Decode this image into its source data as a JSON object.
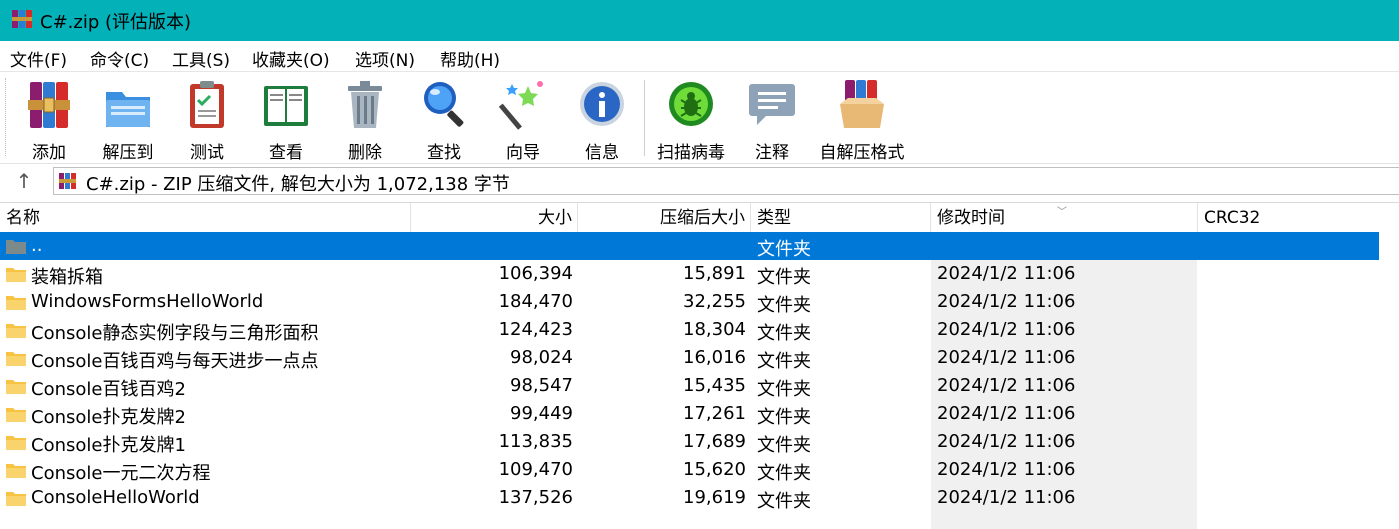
{
  "window": {
    "title": "C#.zip (评估版本)"
  },
  "menu": [
    "文件(F)",
    "命令(C)",
    "工具(S)",
    "收藏夹(O)",
    "选项(N)",
    "帮助(H)"
  ],
  "toolbar": [
    {
      "label": "添加",
      "icon": "add-archive-icon"
    },
    {
      "label": "解压到",
      "icon": "extract-folder-icon"
    },
    {
      "label": "测试",
      "icon": "test-clipboard-icon"
    },
    {
      "label": "查看",
      "icon": "view-book-icon"
    },
    {
      "label": "删除",
      "icon": "trash-icon"
    },
    {
      "label": "查找",
      "icon": "magnifier-icon"
    },
    {
      "label": "向导",
      "icon": "wizard-wand-icon"
    },
    {
      "label": "信息",
      "icon": "info-icon"
    },
    {
      "label": "扫描病毒",
      "icon": "virus-scan-icon"
    },
    {
      "label": "注释",
      "icon": "comment-icon"
    },
    {
      "label": "自解压格式",
      "icon": "sfx-archive-icon"
    }
  ],
  "address": {
    "text": "C#.zip - ZIP 压缩文件, 解包大小为 1,072,138 字节"
  },
  "columns": {
    "name": "名称",
    "size": "大小",
    "packed": "压缩后大小",
    "type": "类型",
    "modified": "修改时间",
    "crc": "CRC32"
  },
  "files": [
    {
      "name": "..",
      "size": "",
      "packed": "",
      "type": "文件夹",
      "modified": ""
    },
    {
      "name": "装箱拆箱",
      "size": "106,394",
      "packed": "15,891",
      "type": "文件夹",
      "modified": "2024/1/2 11:06"
    },
    {
      "name": "WindowsFormsHelloWorld",
      "size": "184,470",
      "packed": "32,255",
      "type": "文件夹",
      "modified": "2024/1/2 11:06"
    },
    {
      "name": "Console静态实例字段与三角形面积",
      "size": "124,423",
      "packed": "18,304",
      "type": "文件夹",
      "modified": "2024/1/2 11:06"
    },
    {
      "name": "Console百钱百鸡与每天进步一点点",
      "size": "98,024",
      "packed": "16,016",
      "type": "文件夹",
      "modified": "2024/1/2 11:06"
    },
    {
      "name": "Console百钱百鸡2",
      "size": "98,547",
      "packed": "15,435",
      "type": "文件夹",
      "modified": "2024/1/2 11:06"
    },
    {
      "name": "Console扑克发牌2",
      "size": "99,449",
      "packed": "17,261",
      "type": "文件夹",
      "modified": "2024/1/2 11:06"
    },
    {
      "name": "Console扑克发牌1",
      "size": "113,835",
      "packed": "17,689",
      "type": "文件夹",
      "modified": "2024/1/2 11:06"
    },
    {
      "name": "Console一元二次方程",
      "size": "109,470",
      "packed": "15,620",
      "type": "文件夹",
      "modified": "2024/1/2 11:06"
    },
    {
      "name": "ConsoleHelloWorld",
      "size": "137,526",
      "packed": "19,619",
      "type": "文件夹",
      "modified": "2024/1/2 11:06"
    }
  ],
  "colors": {
    "titlebar": "#03b1b8",
    "selection": "#0078d7",
    "folder": "#f6c342"
  }
}
